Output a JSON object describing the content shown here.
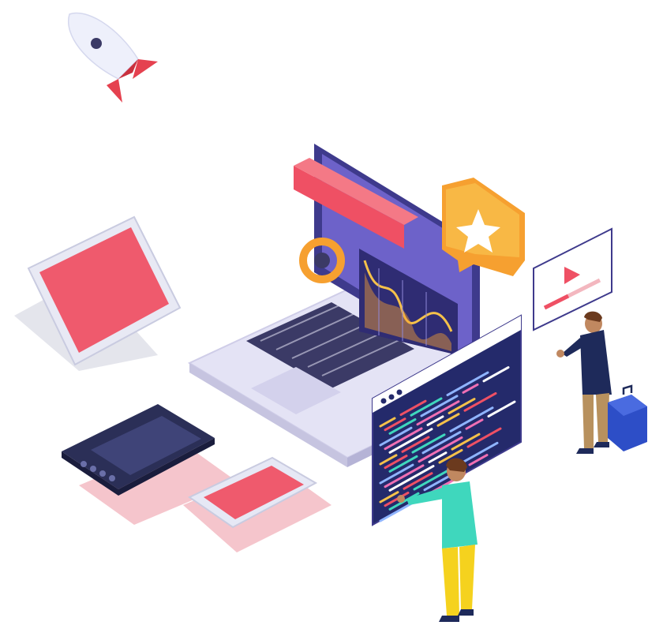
{
  "scene": {
    "kind": "isometric-illustration",
    "background_color": "#ffffff"
  },
  "colors": {
    "laptop_body": "#e4e3f5",
    "laptop_screen": "#6d62c9",
    "laptop_screen_frame": "#3e3a8c",
    "keyboard": "#3b3a66",
    "accent_red": "#ef5064",
    "accent_orange": "#f6a030",
    "accent_yellow": "#f5c14a",
    "code_panel": "#242a6b",
    "tablet_screen": "#ef5a6d",
    "tablet_frame": "#e6e8f5",
    "drawing_tablet": "#2b2f57",
    "shadow_pink": "#f3b7bf",
    "person_shirt_teal": "#3fd7bd",
    "person_pants_yellow": "#f5d21e",
    "person_coat_navy": "#1e2a5a",
    "person_pants_tan": "#b8915e",
    "briefcase": "#2d4ec7"
  },
  "icons": {
    "rocket": "rocket-icon",
    "star_bubble": "star-icon",
    "video_play": "play-icon"
  },
  "code_panel": {
    "window_dots": 3,
    "line_colors": [
      "#f5c14a",
      "#ef5064",
      "#3fd7bd",
      "#8fb4ff",
      "#f06fb4",
      "#ffffff"
    ]
  }
}
